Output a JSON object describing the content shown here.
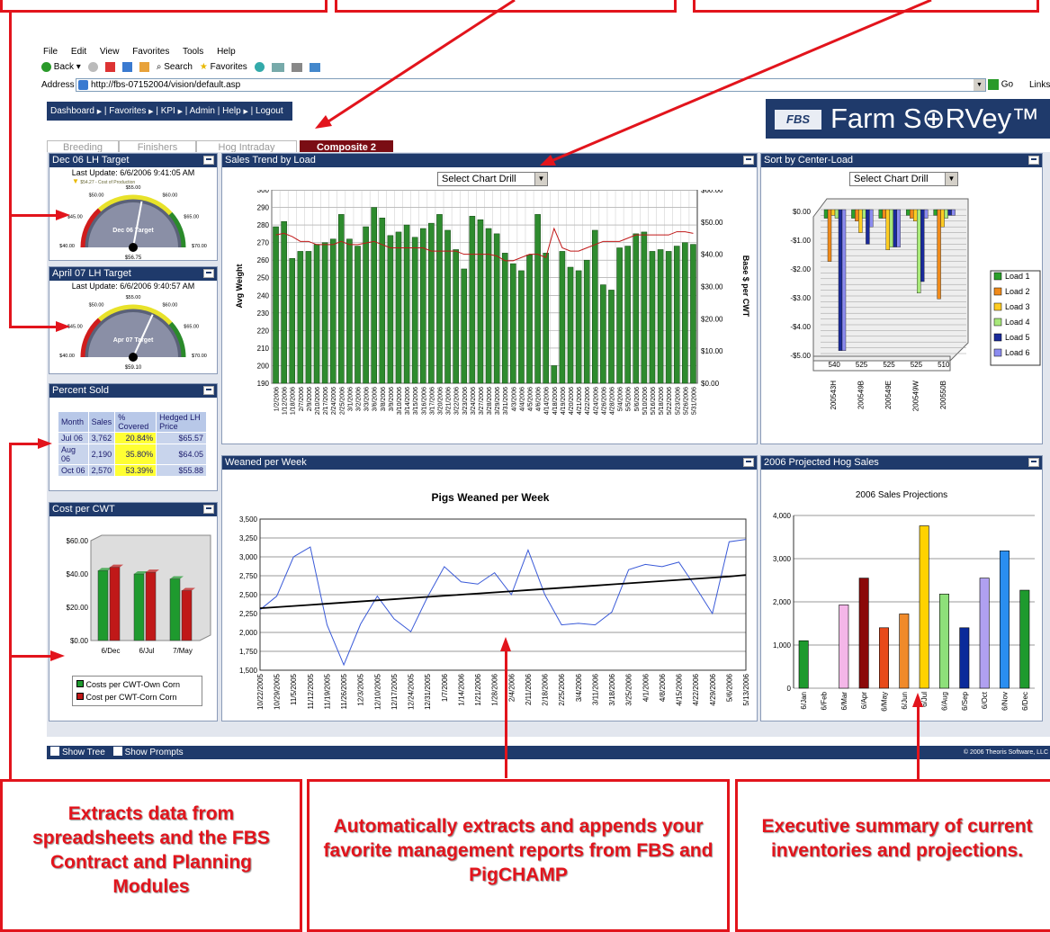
{
  "browser": {
    "menu": [
      "File",
      "Edit",
      "View",
      "Favorites",
      "Tools",
      "Help"
    ],
    "toolbar": {
      "back": "Back",
      "search": "Search",
      "favorites": "Favorites"
    },
    "address_label": "Address",
    "url": "http://fbs-07152004/vision/default.asp",
    "go": "Go",
    "links": "Links"
  },
  "nav": {
    "items": [
      "Dashboard",
      "Favorites",
      "KPI",
      "Admin",
      "Help",
      "Logout"
    ]
  },
  "brand": {
    "name": "Farm S⊕RVey™",
    "logo_text": "FBS"
  },
  "tabs": [
    "Breeding",
    "Finishers",
    "Hog Intraday",
    "Composite 2"
  ],
  "gauge1": {
    "title": "Dec 06 LH Target",
    "update": "Last Update: 6/6/2006 9:41:05 AM",
    "cost_label": "$54.27 - Cost of Production",
    "center_label": "Dec 06 Target",
    "value_label": "$56.75",
    "ticks": [
      "$40.00",
      "$45.00",
      "$50.00",
      "$55.00",
      "$60.00",
      "$65.00",
      "$70.00"
    ],
    "value": 56.75,
    "min": 40,
    "max": 70
  },
  "gauge2": {
    "title": "April 07 LH Target",
    "update": "Last Update: 6/6/2006 9:40:57 AM",
    "center_label": "Apr 07 Target",
    "value_label": "$59.10",
    "ticks": [
      "$40.00",
      "$45.00",
      "$50.00",
      "$55.00",
      "$60.00",
      "$65.00",
      "$70.00"
    ],
    "value": 59.1,
    "min": 40,
    "max": 70
  },
  "percent_sold": {
    "title": "Percent Sold",
    "headers": [
      "Month",
      "Sales",
      "% Covered",
      "Hedged LH Price"
    ],
    "rows": [
      [
        "Jul 06",
        "3,762",
        "20.84%",
        "$65.57"
      ],
      [
        "Aug 06",
        "2,190",
        "35.80%",
        "$64.05"
      ],
      [
        "Oct 06",
        "2,570",
        "53.39%",
        "$55.88"
      ]
    ]
  },
  "cost_cwt": {
    "title": "Cost per CWT",
    "legend": [
      "Costs per CWT-Own Corn",
      "Cost per CWT-Corn Corn"
    ]
  },
  "sales_trend": {
    "title": "Sales Trend by Load",
    "select": "Select Chart Drill"
  },
  "center_load": {
    "title": "Sort by Center-Load",
    "select": "Select Chart Drill",
    "table_values": [
      "540",
      "525",
      "525",
      "525",
      "510"
    ]
  },
  "weaned": {
    "title": "Weaned per Week"
  },
  "projected": {
    "title": "2006 Projected Hog Sales"
  },
  "footer": {
    "show_tree": "Show Tree",
    "show_prompts": "Show Prompts",
    "copyright": "© 2006 Theoris Software, LLC"
  },
  "callouts": [
    "Extracts data from spreadsheets and the FBS Contract and Planning Modules",
    "Automatically extracts and appends your favorite management reports from FBS and PigCHAMP",
    "Executive summary of current inventories and projections."
  ],
  "colors": {
    "accent": "#e2141c",
    "panel_header": "#1f3a6b",
    "bar_green": "#2e8b2e"
  },
  "chart_data": [
    {
      "type": "bar",
      "id": "sales_trend",
      "xlabel": "",
      "ylabel": "Avg Weight",
      "y2label": "Base $ per CWT",
      "ylim": [
        190,
        300
      ],
      "y2lim": [
        0,
        60
      ],
      "yticks": [
        "300",
        "290",
        "280",
        "270",
        "260",
        "250",
        "240",
        "230",
        "220",
        "210",
        "200",
        "190"
      ],
      "y2ticks": [
        "$60.00",
        "$50.00",
        "$40.00",
        "$30.00",
        "$20.00",
        "$10.00",
        "$0.00"
      ],
      "categories": [
        "1/2/2006",
        "1/12/2006",
        "1/18/2006",
        "2/7/2006",
        "2/9/2006",
        "2/10/2006",
        "2/17/2006",
        "2/24/2006",
        "2/25/2006",
        "3/1/2006",
        "3/2/2006",
        "3/3/2006",
        "3/6/2006",
        "3/8/2006",
        "3/9/2006",
        "3/10/2006",
        "3/14/2006",
        "3/15/2006",
        "3/16/2006",
        "3/17/2006",
        "3/20/2006",
        "3/21/2006",
        "3/22/2006",
        "3/23/2006",
        "3/24/2006",
        "3/27/2006",
        "3/28/2006",
        "3/29/2006",
        "3/31/2006",
        "4/3/2006",
        "4/4/2006",
        "4/5/2006",
        "4/6/2006",
        "4/14/2006",
        "4/18/2006",
        "4/19/2006",
        "4/20/2006",
        "4/21/2006",
        "4/22/2006",
        "4/24/2006",
        "4/26/2006",
        "4/28/2006",
        "5/4/2006",
        "5/5/2006",
        "5/6/2006",
        "5/10/2006",
        "5/16/2006",
        "5/18/2006",
        "5/22/2006",
        "5/23/2006",
        "5/26/2006",
        "5/31/2006"
      ],
      "series": [
        {
          "name": "Avg Weight",
          "values": [
            279,
            282,
            261,
            265,
            265,
            269,
            270,
            272,
            286,
            272,
            268,
            279,
            290,
            284,
            274,
            276,
            280,
            273,
            278,
            281,
            286,
            277,
            266,
            255,
            285,
            283,
            278,
            275,
            264,
            258,
            254,
            263,
            286,
            264,
            200,
            265,
            256,
            254,
            260,
            277,
            246,
            243,
            267,
            268,
            275,
            276,
            265,
            266,
            265,
            268,
            270,
            269
          ]
        },
        {
          "name": "Base $ per CWT",
          "values": [
            46,
            46.5,
            45.5,
            44,
            44,
            43,
            43,
            43,
            44,
            43,
            43,
            43.5,
            44,
            43,
            42,
            42,
            42,
            42,
            42,
            41,
            41,
            41,
            41,
            40,
            40,
            40,
            40,
            39.5,
            38,
            38,
            39,
            40,
            40,
            39,
            48,
            42,
            41,
            41,
            42,
            43,
            44,
            44,
            44,
            45,
            46,
            46,
            46,
            46,
            46,
            47,
            47,
            46.5
          ]
        }
      ]
    },
    {
      "type": "bar",
      "id": "center_load",
      "categories": [
        "200543H",
        "200549B",
        "200549E",
        "200549W",
        "200550B"
      ],
      "ylim": [
        -5,
        0
      ],
      "yticks": [
        "$0.00",
        "-$1.00",
        "-$2.00",
        "-$3.00",
        "-$4.00",
        "-$5.00"
      ],
      "series": [
        {
          "name": "Load 1",
          "values": [
            -0.3,
            -0.3,
            -0.3,
            -0.2,
            -0.2
          ]
        },
        {
          "name": "Load 2",
          "values": [
            -1.8,
            -0.4,
            -0.3,
            -0.3,
            -3.1
          ]
        },
        {
          "name": "Load 3",
          "values": [
            -0.2,
            -0.8,
            -1.4,
            -0.4,
            -0.6
          ]
        },
        {
          "name": "Load 4",
          "values": [
            -0.3,
            -0.3,
            -1.3,
            -2.9,
            -0.3
          ]
        },
        {
          "name": "Load 5",
          "values": [
            -4.9,
            -1.2,
            -1.3,
            -2.5,
            -0.2
          ]
        },
        {
          "name": "Load 6",
          "values": [
            -4.9,
            -0.6,
            -1.3,
            -0.3,
            -0.2
          ]
        }
      ]
    },
    {
      "type": "bar",
      "id": "cost_cwt",
      "categories": [
        "6/Dec",
        "6/Jul",
        "7/May"
      ],
      "ylim": [
        0,
        60
      ],
      "yticks": [
        "$60.00",
        "$40.00",
        "$20.00",
        "$0.00"
      ],
      "series": [
        {
          "name": "Costs per CWT-Own Corn",
          "values": [
            42,
            40,
            37
          ]
        },
        {
          "name": "Cost per CWT-Corn Corn",
          "values": [
            44,
            41,
            30
          ]
        }
      ]
    },
    {
      "type": "line",
      "id": "weaned",
      "title": "Pigs Weaned per Week",
      "ylim": [
        1500,
        3500
      ],
      "yticks": [
        "3,500",
        "3,250",
        "3,000",
        "2,750",
        "2,500",
        "2,250",
        "2,000",
        "1,750",
        "1,500"
      ],
      "x": [
        "10/22/2005",
        "10/29/2005",
        "11/5/2005",
        "11/12/2005",
        "11/19/2005",
        "11/26/2005",
        "12/3/2005",
        "12/10/2005",
        "12/17/2005",
        "12/24/2005",
        "12/31/2005",
        "1/7/2006",
        "1/14/2006",
        "1/21/2006",
        "1/28/2006",
        "2/4/2006",
        "2/11/2006",
        "2/18/2006",
        "2/25/2006",
        "3/4/2006",
        "3/11/2006",
        "3/18/2006",
        "3/25/2006",
        "4/1/2006",
        "4/8/2006",
        "4/15/2006",
        "4/22/2006",
        "4/29/2006",
        "5/6/2006",
        "5/13/2006"
      ],
      "xticks": [
        "10/22/2005",
        "10/29/2005",
        "11/5/2005",
        "11/12/2005",
        "11/19/2005",
        "11/26/2005",
        "12/3/2005",
        "12/10/2005",
        "12/17/2005",
        "12/24/2005",
        "12/31/2005",
        "1/7/2006",
        "1/14/2006",
        "1/21/2006",
        "1/28/2006",
        "2/4/2006",
        "2/11/2006",
        "2/18/2006",
        "2/25/2006",
        "3/4/2006",
        "3/11/2006",
        "3/18/2006",
        "3/25/2006",
        "4/1/2006",
        "4/8/2006",
        "4/15/2006",
        "4/22/2006",
        "4/29/2006",
        "5/6/2006",
        "5/13/2006"
      ],
      "series": [
        {
          "values": [
            2300,
            2480,
            3000,
            3130,
            2100,
            1570,
            2110,
            2480,
            2180,
            2010,
            2470,
            2870,
            2670,
            2640,
            2790,
            2500,
            3090,
            2500,
            2100,
            2120,
            2100,
            2270,
            2830,
            2900,
            2870,
            2930,
            2600,
            2250,
            3200,
            3230
          ]
        },
        {
          "values": [
            2320,
            2335,
            2350,
            2365,
            2380,
            2395,
            2410,
            2425,
            2440,
            2455,
            2470,
            2485,
            2500,
            2515,
            2530,
            2545,
            2560,
            2575,
            2590,
            2605,
            2620,
            2635,
            2650,
            2665,
            2680,
            2695,
            2710,
            2725,
            2740,
            2760
          ]
        }
      ]
    },
    {
      "type": "bar",
      "id": "projected",
      "title": "2006 Sales Projections",
      "categories": [
        "6/Jan",
        "6/Feb",
        "6/Mar",
        "6/Apr",
        "6/May",
        "6/Jun",
        "6/Jul",
        "6/Aug",
        "6/Sep",
        "6/Oct",
        "6/Nov",
        "6/Dec"
      ],
      "ylim": [
        0,
        4000
      ],
      "yticks": [
        "4,000",
        "3,000",
        "2,000",
        "1,000",
        "0"
      ],
      "values": [
        1100,
        0,
        1930,
        2550,
        1400,
        1720,
        3760,
        2180,
        1400,
        2550,
        3180,
        2270
      ],
      "colors": [
        "#1e9a2e",
        "#ffffff",
        "#f4b6e8",
        "#8b0a0a",
        "#e84a1a",
        "#f08a2a",
        "#ffd200",
        "#8ee07a",
        "#0a2a9a",
        "#b0a0f0",
        "#2a8ef0",
        "#1e9a2e"
      ]
    }
  ]
}
